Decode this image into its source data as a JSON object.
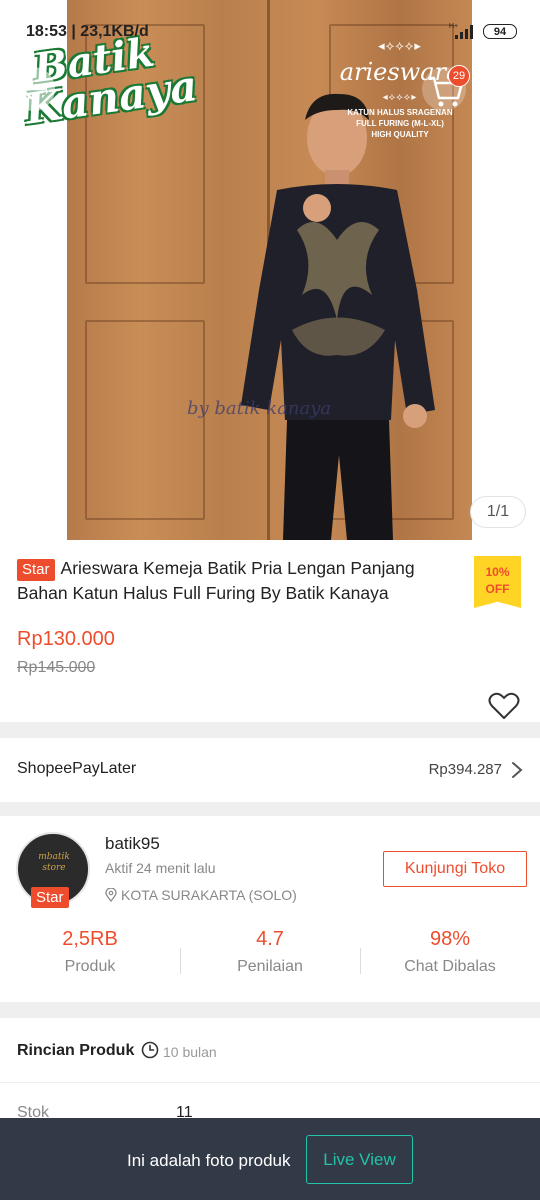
{
  "status_bar": {
    "time": "18:53 | 23,1KB/d",
    "network": "H+",
    "battery": "94"
  },
  "hero": {
    "logo_line1": "Batik",
    "logo_line2": "Kanaya",
    "brand_name": "arieswara",
    "brand_sub": [
      "KATUN HALUS SRAGENAN",
      "FULL FURING (M-L-XL)",
      "HIGH QUALITY"
    ],
    "watermark": "by batik kanaya",
    "cart_count": "29",
    "image_counter": "1/1",
    "icons": {
      "back": "arrow-left-icon",
      "cart": "cart-icon",
      "more": "more-vertical-icon"
    }
  },
  "product": {
    "badge": "Star",
    "title": "Arieswara Kemeja Batik Pria Lengan Panjang Bahan Katun Halus Full Furing By Batik Kanaya",
    "discount_pct": "10%",
    "discount_word": "OFF",
    "price": "Rp130.000",
    "original_price": "Rp145.000",
    "accent_color": "#ee4d2d"
  },
  "paylater": {
    "label": "ShopeePayLater",
    "amount": "Rp394.287"
  },
  "shop": {
    "name": "batik95",
    "active": "Aktif 24 menit lalu",
    "location": "KOTA SURAKARTA (SOLO)",
    "badge": "Star",
    "visit_label": "Kunjungi Toko",
    "avatar_text": "mbatik store",
    "stats": [
      {
        "value": "2,5RB",
        "label": "Produk"
      },
      {
        "value": "4.7",
        "label": "Penilaian"
      },
      {
        "value": "98%",
        "label": "Chat Dibalas"
      }
    ]
  },
  "details": {
    "heading": "Rincian Produk",
    "updated": "10 bulan",
    "rows": [
      {
        "key": "Stok",
        "value": "11"
      }
    ]
  },
  "bottom_bar": {
    "message": "Ini adalah foto produk",
    "button": "Live View",
    "button_color": "#22c3a8"
  }
}
